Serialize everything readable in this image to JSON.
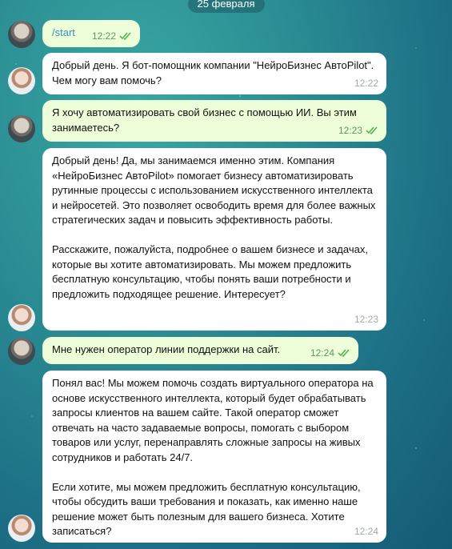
{
  "date_label": "25 февраля",
  "messages": [
    {
      "side": "out",
      "text": "/start",
      "time": "12:22"
    },
    {
      "side": "in",
      "text": "Добрый день. Я бот-помощник компании \"НейроБизнес АвтоPilot\". Чем могу вам помочь?",
      "time": "12:22"
    },
    {
      "side": "out",
      "text": "Я хочу автоматизировать свой бизнес с помощью ИИ. Вы этим занимаетесь?",
      "time": "12:23"
    },
    {
      "side": "in",
      "text": "Добрый день! Да, мы занимаемся именно этим. Компания «НейроБизнес АвтоPilot» помогает бизнесу автоматизировать рутинные процессы с использованием искусственного интеллекта и нейросетей. Это позволяет освободить время для более важных стратегических задач и повысить эффективность работы.\n\nРасскажите, пожалуйста, подробнее о вашем бизнесе и задачах, которые вы хотите автоматизировать. Мы можем предложить бесплатную консультацию, чтобы понять ваши потребности и предложить подходящее решение. Интересует?",
      "time": "12:23"
    },
    {
      "side": "out",
      "text": "Мне нужен оператор линии поддержки на сайт.",
      "time": "12:24"
    },
    {
      "side": "in",
      "text": "Понял вас! Мы можем помочь создать виртуального оператора на основе искусственного интеллекта, который будет обрабатывать запросы клиентов на вашем сайте. Такой оператор сможет отвечать на часто задаваемые вопросы, помогать с выбором товаров или услуг, перенаправлять сложные запросы на живых сотрудников и работать 24/7.\n\nЕсли хотите, мы можем предложить бесплатную консультацию, чтобы обсудить ваши требования и показать, как именно наше решение может быть полезным для вашего бизнеса. Хотите записаться?",
      "time": "12:24"
    }
  ]
}
